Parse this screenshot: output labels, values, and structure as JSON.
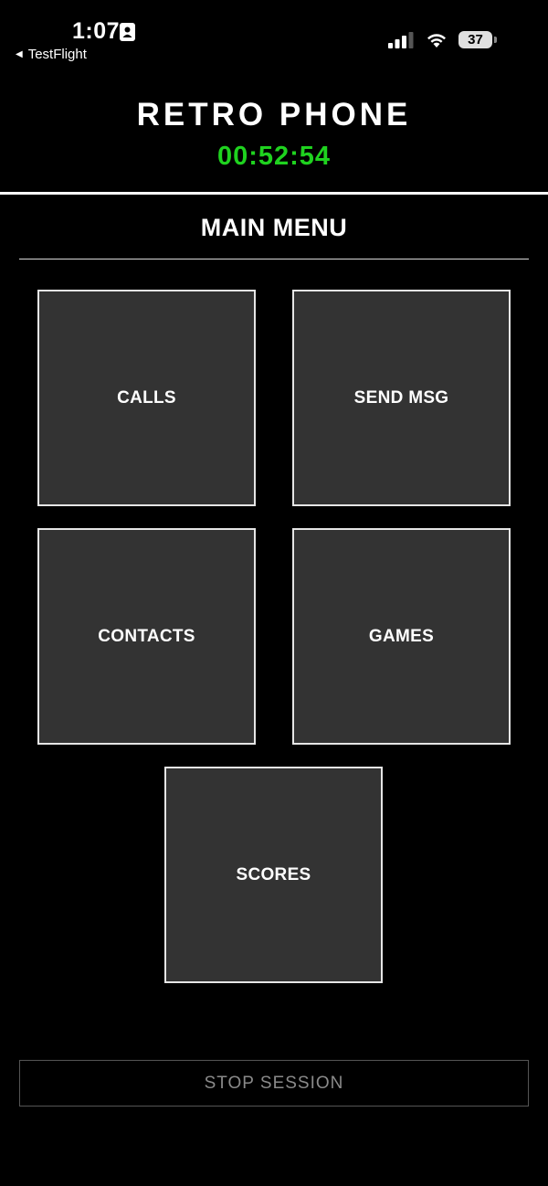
{
  "status_bar": {
    "time": "1:07",
    "back_app": "TestFlight",
    "battery_level": "37",
    "icons": [
      "id-card-icon",
      "signal-icon",
      "wifi-icon",
      "battery-icon"
    ]
  },
  "header": {
    "title": "RETRO PHONE",
    "timer": "00:52:54"
  },
  "menu": {
    "title": "MAIN MENU",
    "tiles": [
      {
        "label": "CALLS"
      },
      {
        "label": "SEND MSG"
      },
      {
        "label": "CONTACTS"
      },
      {
        "label": "GAMES"
      },
      {
        "label": "SCORES"
      }
    ]
  },
  "footer": {
    "stop_label": "STOP SESSION"
  },
  "colors": {
    "background": "#000000",
    "tile_fill": "#333333",
    "tile_border": "#e6e6e6",
    "timer_green": "#1fd21f",
    "stop_text": "#8a8a8a"
  }
}
